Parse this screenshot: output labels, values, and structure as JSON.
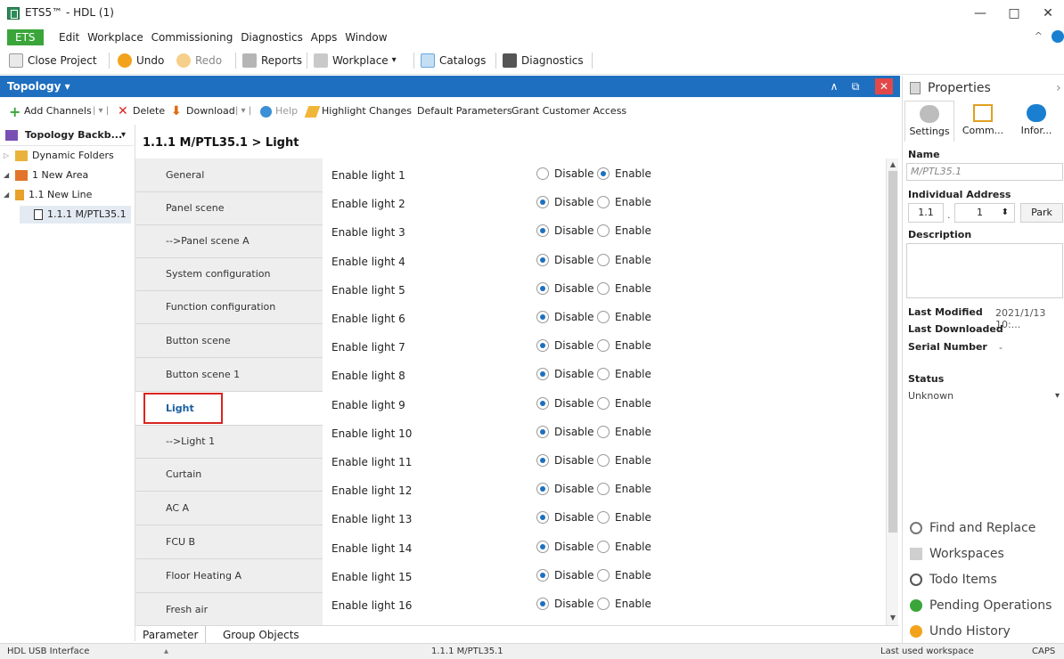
{
  "window": {
    "title": "ETS5™ - HDL (1)",
    "minimize": "—",
    "maximize": "□",
    "close": "✕"
  },
  "menu": {
    "app_button": "ETS",
    "items": [
      "Edit",
      "Workplace",
      "Commissioning",
      "Diagnostics",
      "Apps",
      "Window"
    ],
    "collapse": "^"
  },
  "toolbar": {
    "close_project": "Close Project",
    "undo": "Undo",
    "redo": "Redo",
    "reports": "Reports",
    "workplace": "Workplace",
    "workplace_arrow": "▾",
    "catalogs": "Catalogs",
    "diagnostics": "Diagnostics"
  },
  "topology": {
    "header": "Topology ▾",
    "ctl_up": "∧",
    "ctl_restore": "⧉",
    "ctl_close": "✕",
    "actions": {
      "add_channels": "Add Channels",
      "sep_arrow": "| ▾ |",
      "delete": "Delete",
      "download": "Download",
      "download_arrow": "| ▾ |",
      "help": "Help",
      "highlight": "Highlight Changes",
      "default_params": "Default Parameters",
      "grant_access": "Grant Customer Access"
    },
    "tree": {
      "header": "Topology Backb...",
      "header_arrow": "▾",
      "items": [
        {
          "label": "Dynamic Folders",
          "expander": "▷"
        },
        {
          "label": "1 New Area",
          "expander": "◢"
        },
        {
          "label": "1.1 New Line",
          "expander": "◢"
        },
        {
          "label": "1.1.1 M/PTL35.1",
          "expander": ""
        }
      ]
    }
  },
  "breadcrumb": "1.1.1 M/PTL35.1 > Light",
  "param_nav": [
    {
      "label": "General"
    },
    {
      "label": "Panel scene"
    },
    {
      "label": "-->Panel scene A"
    },
    {
      "label": "System configuration"
    },
    {
      "label": "Function configuration"
    },
    {
      "label": "Button scene"
    },
    {
      "label": "Button scene 1"
    },
    {
      "label": "Light"
    },
    {
      "label": "-->Light 1"
    },
    {
      "label": "Curtain"
    },
    {
      "label": "AC A"
    },
    {
      "label": "FCU B"
    },
    {
      "label": "Floor Heating A"
    },
    {
      "label": "Fresh air"
    }
  ],
  "params": {
    "disable_label": "Disable",
    "enable_label": "Enable",
    "rows": [
      {
        "label": "Enable light 1",
        "value": "Enable"
      },
      {
        "label": "Enable light 2",
        "value": "Disable"
      },
      {
        "label": "Enable light 3",
        "value": "Disable"
      },
      {
        "label": "Enable light 4",
        "value": "Disable"
      },
      {
        "label": "Enable light 5",
        "value": "Disable"
      },
      {
        "label": "Enable light 6",
        "value": "Disable"
      },
      {
        "label": "Enable light 7",
        "value": "Disable"
      },
      {
        "label": "Enable light 8",
        "value": "Disable"
      },
      {
        "label": "Enable light 9",
        "value": "Disable"
      },
      {
        "label": "Enable light 10",
        "value": "Disable"
      },
      {
        "label": "Enable light 11",
        "value": "Disable"
      },
      {
        "label": "Enable light 12",
        "value": "Disable"
      },
      {
        "label": "Enable light 13",
        "value": "Disable"
      },
      {
        "label": "Enable light 14",
        "value": "Disable"
      },
      {
        "label": "Enable light 15",
        "value": "Disable"
      },
      {
        "label": "Enable light 16",
        "value": "Disable"
      }
    ]
  },
  "scroll": {
    "up": "▲",
    "down": "▼"
  },
  "bottom_tabs": [
    "Parameter",
    "Group Objects"
  ],
  "statusbar": {
    "interface": "HDL USB Interface",
    "up_arrow": "▴",
    "device": "1.1.1 M/PTL35.1",
    "workspace": "Last used workspace",
    "caps": "CAPS"
  },
  "properties": {
    "title": "Properties",
    "collapse": "›",
    "tabs": [
      "Settings",
      "Comm...",
      "Infor..."
    ],
    "name_label": "Name",
    "name_value": "M/PTL35.1",
    "address_label": "Individual Address",
    "address_prefix": "1.1",
    "address_sep": ".",
    "address_value": "1",
    "stepper": "⬍",
    "park": "Park",
    "description_label": "Description",
    "last_modified_label": "Last Modified",
    "last_modified_value": "2021/1/13 10:...",
    "last_downloaded_label": "Last Downloaded",
    "last_downloaded_value": "-",
    "serial_label": "Serial Number",
    "serial_value": "-",
    "status_label": "Status",
    "status_value": "Unknown",
    "status_arrow": "▾"
  },
  "side_links": [
    "Find and Replace",
    "Workspaces",
    "Todo Items",
    "Pending Operations",
    "Undo History"
  ],
  "colors": {
    "accent": "#1e6fbf",
    "ets_green": "#3aa53a",
    "highlight_red": "#d7261f"
  }
}
